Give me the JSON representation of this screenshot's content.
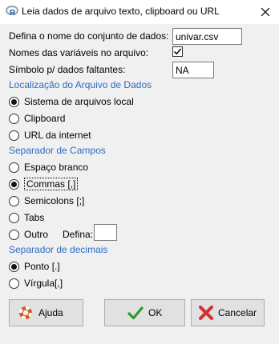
{
  "window": {
    "title": "Leia dados de arquivo texto, clipboard ou URL"
  },
  "form": {
    "dataset_label": "Defina o nome do conjunto de dados:",
    "dataset_value": "univar.csv",
    "varnames_label": "Nomes das variáveis no arquivo:",
    "varnames_checked": true,
    "missing_label": "Símbolo p/ dados faltantes:",
    "missing_value": "NA"
  },
  "location": {
    "heading": "Localização do Arquivo de Dados",
    "options": [
      {
        "label": "Sistema de arquivos local",
        "selected": true
      },
      {
        "label": "Clipboard",
        "selected": false
      },
      {
        "label": "URL da internet",
        "selected": false
      }
    ]
  },
  "field_separator": {
    "heading": "Separador de Campos",
    "options": [
      {
        "label": "Espaço branco",
        "selected": false
      },
      {
        "label": "Commas [,]",
        "selected": true
      },
      {
        "label": "Semicolons [;]",
        "selected": false
      },
      {
        "label": "Tabs",
        "selected": false
      },
      {
        "label": "Outro",
        "selected": false
      }
    ],
    "other_label": "Defina:",
    "other_value": ""
  },
  "decimal_separator": {
    "heading": "Separador de decimais",
    "options": [
      {
        "label": "Ponto [.]",
        "selected": true
      },
      {
        "label": "Vírgula[,]",
        "selected": false
      }
    ]
  },
  "buttons": {
    "help": "Ajuda",
    "ok": "OK",
    "cancel": "Cancelar"
  },
  "icons": {
    "app": "r-logo-icon",
    "close": "close-icon",
    "help": "lifebuoy-icon",
    "ok": "checkmark-icon",
    "cancel": "red-x-icon"
  },
  "colors": {
    "section_heading": "#2b6cc4",
    "ok_check": "#2e9a2e",
    "cancel_x": "#d32f2f"
  }
}
